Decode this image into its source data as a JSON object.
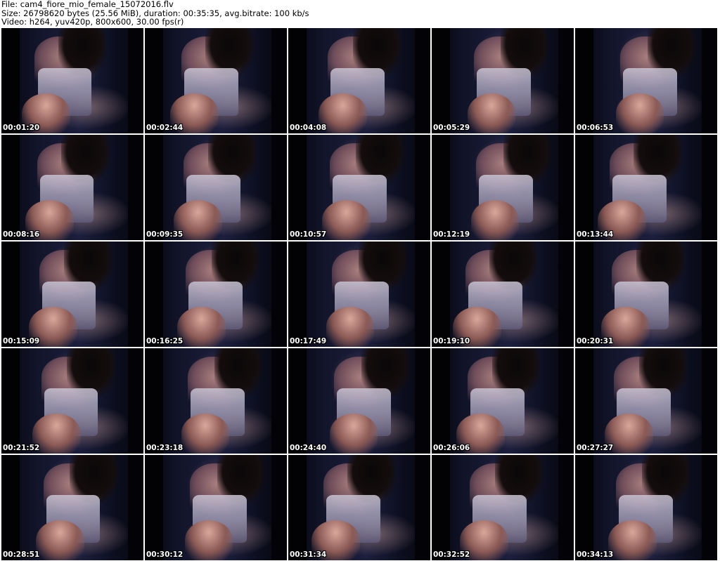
{
  "header": {
    "file_line": "File: cam4_fiore_mio_female_15072016.flv",
    "size_line": "Size: 26798620 bytes (25.56 MiB), duration: 00:35:35, avg.bitrate: 100 kb/s",
    "video_line": "Video: h264, yuv420p, 800x600, 30.00 fps(r)"
  },
  "thumbnails": [
    {
      "timestamp": "00:01:20"
    },
    {
      "timestamp": "00:02:44"
    },
    {
      "timestamp": "00:04:08"
    },
    {
      "timestamp": "00:05:29"
    },
    {
      "timestamp": "00:06:53"
    },
    {
      "timestamp": "00:08:16"
    },
    {
      "timestamp": "00:09:35"
    },
    {
      "timestamp": "00:10:57"
    },
    {
      "timestamp": "00:12:19"
    },
    {
      "timestamp": "00:13:44"
    },
    {
      "timestamp": "00:15:09"
    },
    {
      "timestamp": "00:16:25"
    },
    {
      "timestamp": "00:17:49"
    },
    {
      "timestamp": "00:19:10"
    },
    {
      "timestamp": "00:20:31"
    },
    {
      "timestamp": "00:21:52"
    },
    {
      "timestamp": "00:23:18"
    },
    {
      "timestamp": "00:24:40"
    },
    {
      "timestamp": "00:26:06"
    },
    {
      "timestamp": "00:27:27"
    },
    {
      "timestamp": "00:28:51"
    },
    {
      "timestamp": "00:30:12"
    },
    {
      "timestamp": "00:31:34"
    },
    {
      "timestamp": "00:32:52"
    },
    {
      "timestamp": "00:34:13"
    }
  ]
}
